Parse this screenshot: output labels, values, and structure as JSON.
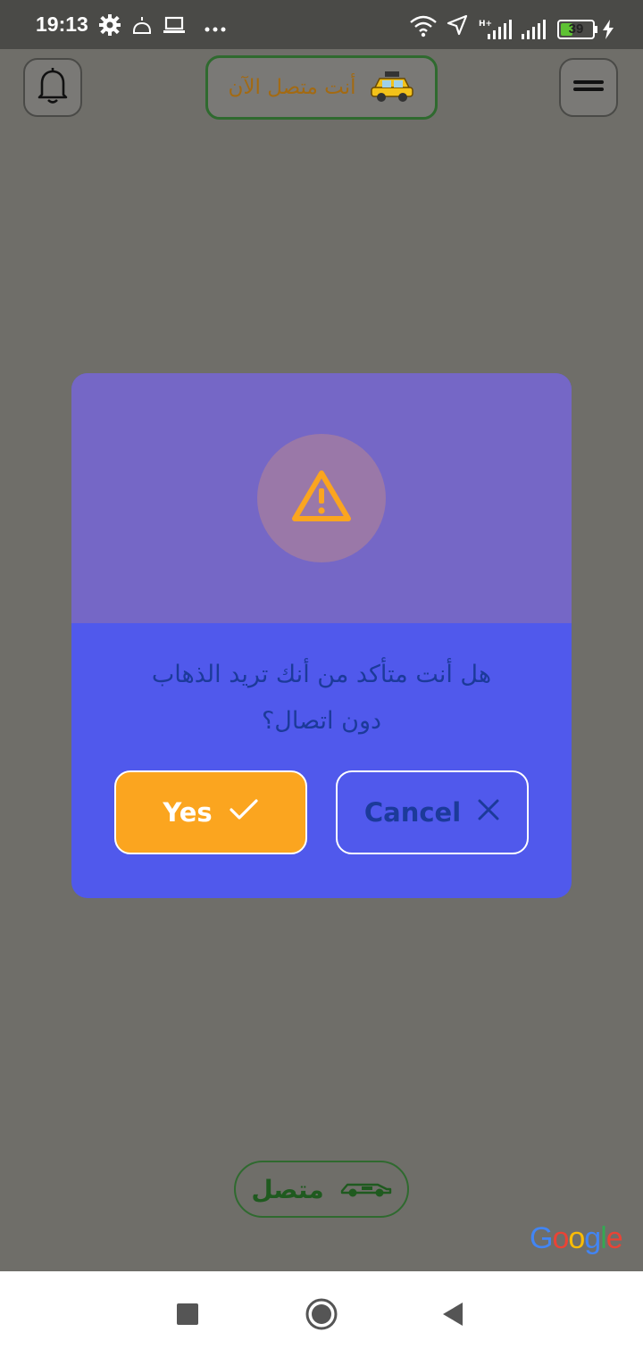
{
  "status_bar": {
    "time": "19:13",
    "battery": "39",
    "battery_level": 0.39,
    "icons": [
      "gear-icon",
      "alarm-icon",
      "laptop-icon",
      "more-icon",
      "wifi-icon",
      "location-icon",
      "signal-icon",
      "signal-icon",
      "battery-icon",
      "charging-icon"
    ]
  },
  "app": {
    "status_pill": {
      "label": "أنت متصل الآن",
      "icon": "taxi-icon"
    },
    "online_pill": {
      "label": "متصل",
      "icon": "car-icon"
    },
    "map_attribution": "Google"
  },
  "dialog": {
    "icon": "warning-icon",
    "message_line1": "هل أنت متأكد من أنك تريد الذهاب",
    "message_line2": "دون اتصال؟",
    "yes_label": "Yes",
    "cancel_label": "Cancel"
  },
  "colors": {
    "dialog_header": "#7567c6",
    "dialog_body": "#5059ec",
    "accent": "#fba51f",
    "text_dark_blue": "#1c3a9a",
    "online_green": "#2f6a2f"
  },
  "nav_bar": {
    "icons": [
      "recents-icon",
      "home-icon",
      "back-icon"
    ]
  }
}
